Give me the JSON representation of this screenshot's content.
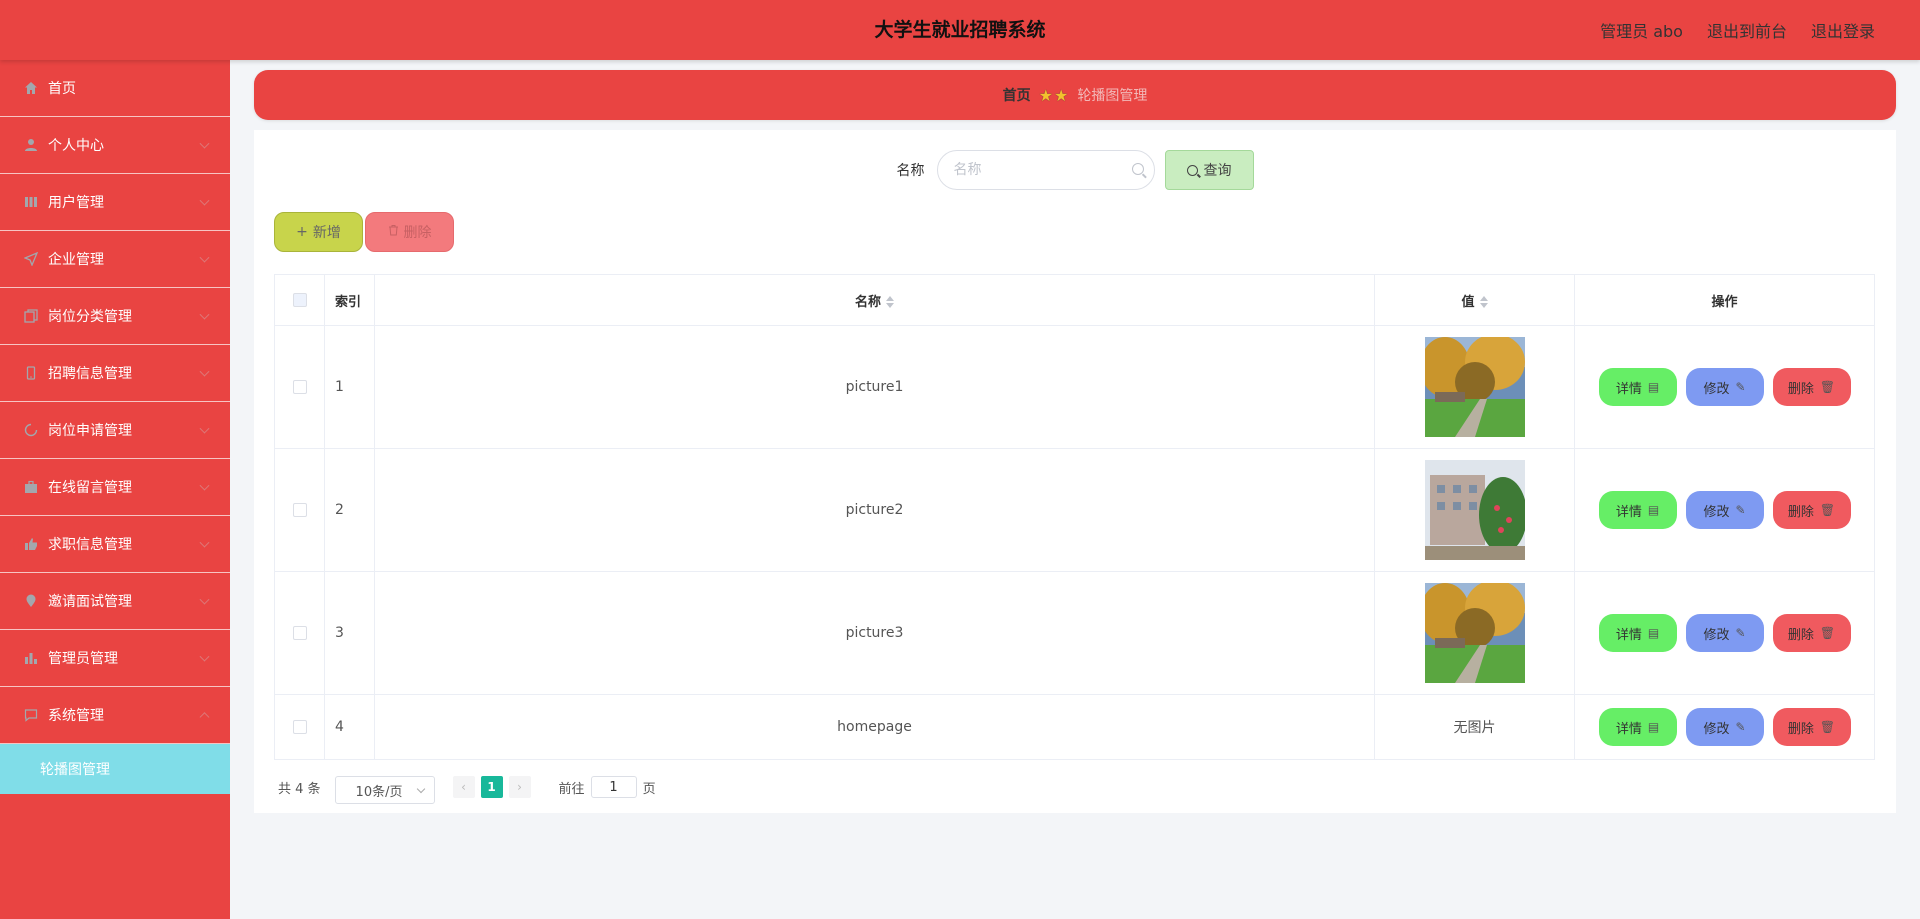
{
  "header": {
    "title": "大学生就业招聘系统",
    "user_label": "管理员 abo",
    "front_label": "退出到前台",
    "logout_label": "退出登录"
  },
  "sidebar": {
    "items": [
      {
        "label": "首页",
        "icon": "home-icon"
      },
      {
        "label": "个人中心",
        "icon": "user-icon"
      },
      {
        "label": "用户管理",
        "icon": "users-icon"
      },
      {
        "label": "企业管理",
        "icon": "navigation-icon"
      },
      {
        "label": "岗位分类管理",
        "icon": "copy-icon"
      },
      {
        "label": "招聘信息管理",
        "icon": "mobile-icon"
      },
      {
        "label": "岗位申请管理",
        "icon": "loading-icon"
      },
      {
        "label": "在线留言管理",
        "icon": "briefcase-icon"
      },
      {
        "label": "求职信息管理",
        "icon": "thumb-icon"
      },
      {
        "label": "邀请面试管理",
        "icon": "location-icon"
      },
      {
        "label": "管理员管理",
        "icon": "bar-chart-icon"
      },
      {
        "label": "系统管理",
        "icon": "chat-icon"
      }
    ],
    "active_sub": "轮播图管理"
  },
  "breadcrumb": {
    "home": "首页",
    "current": "轮播图管理"
  },
  "search": {
    "label": "名称",
    "placeholder": "名称",
    "button": "查询"
  },
  "actions": {
    "add": "新增",
    "delete": "删除"
  },
  "table": {
    "headers": {
      "index": "索引",
      "name": "名称",
      "value": "值",
      "ops": "操作"
    },
    "rows": [
      {
        "index": "1",
        "name": "picture1",
        "value": ""
      },
      {
        "index": "2",
        "name": "picture2",
        "value": ""
      },
      {
        "index": "3",
        "name": "picture3",
        "value": ""
      },
      {
        "index": "4",
        "name": "homepage",
        "value": "无图片"
      }
    ],
    "op_labels": {
      "detail": "详情",
      "edit": "修改",
      "remove": "删除"
    }
  },
  "pagination": {
    "total": "共 4 条",
    "page_size": "10条/页",
    "current_page": "1",
    "goto_prefix": "前往",
    "goto_value": "1",
    "goto_suffix": "页"
  },
  "colors": {
    "primary": "#e94442",
    "submenu_active": "#80dde8",
    "detail": "#66ee66",
    "edit": "#7e9af2",
    "remove": "#f05a5f",
    "page_active": "#18b89a"
  }
}
